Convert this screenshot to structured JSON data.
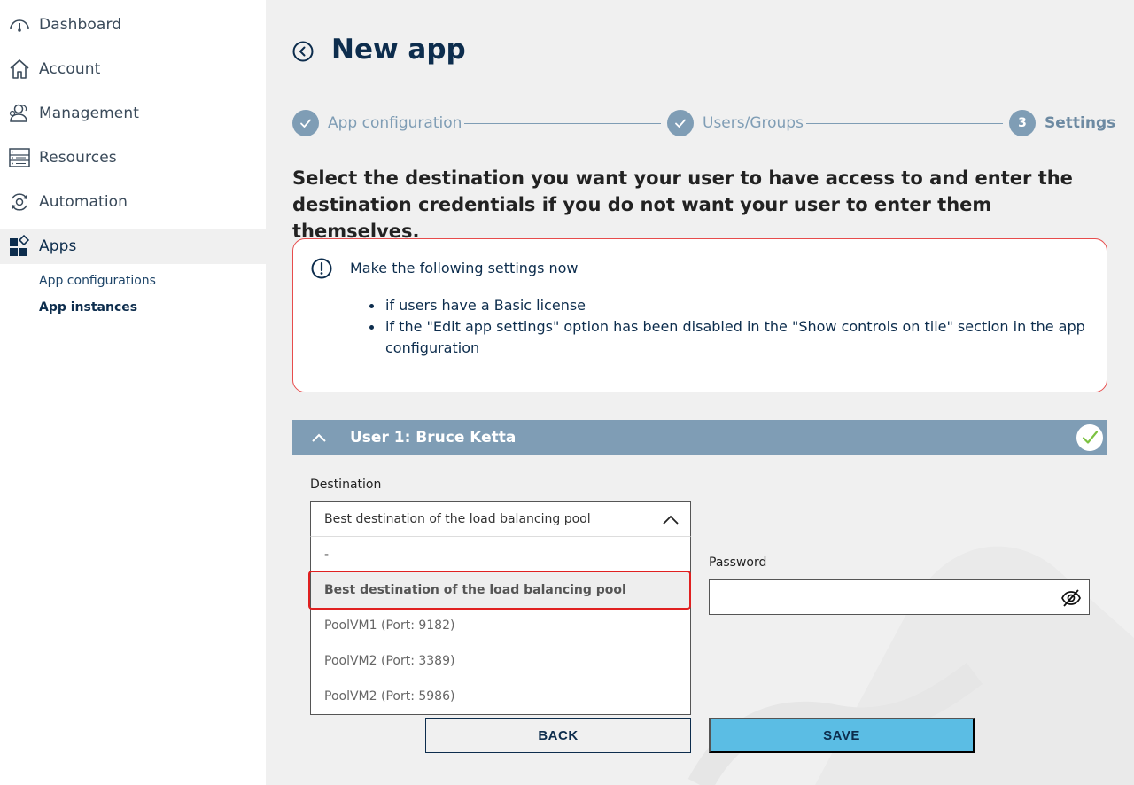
{
  "sidebar": {
    "items": [
      {
        "label": "Dashboard",
        "icon": "gauge-icon"
      },
      {
        "label": "Account",
        "icon": "home-icon"
      },
      {
        "label": "Management",
        "icon": "users-icon"
      },
      {
        "label": "Resources",
        "icon": "server-icon"
      },
      {
        "label": "Automation",
        "icon": "automation-icon"
      },
      {
        "label": "Apps",
        "icon": "apps-icon"
      }
    ],
    "active_item": "Apps",
    "sub_items": [
      {
        "label": "App configurations"
      },
      {
        "label": "App instances"
      }
    ],
    "active_sub_item": "App instances"
  },
  "page": {
    "title": "New app",
    "heading": "Select the destination you want your user to have access to and enter the destination credentials if you do not want your user to enter them themselves."
  },
  "stepper": {
    "steps": [
      {
        "label": "App configuration",
        "state": "done"
      },
      {
        "label": "Users/Groups",
        "state": "done"
      },
      {
        "label": "Settings",
        "state": "current",
        "number": "3"
      }
    ]
  },
  "notice": {
    "title": "Make the following settings now",
    "bullets": [
      "if users have a Basic license",
      "if the \"Edit app settings\" option has been disabled in the \"Show controls on tile\" section in the app configuration"
    ]
  },
  "user_section": {
    "title": "User 1: Bruce Ketta",
    "status": "complete"
  },
  "destination": {
    "label": "Destination",
    "value": "Best destination of the load balancing pool",
    "options": [
      "-",
      "Best destination of the load balancing pool",
      "PoolVM1 (Port: 9182)",
      "PoolVM2 (Port: 3389)",
      "PoolVM2 (Port: 5986)"
    ],
    "selected_option": "Best destination of the load balancing pool"
  },
  "password": {
    "label": "Password",
    "value": ""
  },
  "buttons": {
    "back": "BACK",
    "save": "SAVE"
  },
  "colors": {
    "navy": "#0d2d4d",
    "step_blue": "#7f9db5",
    "save_blue": "#5bbde4",
    "alert_red": "#e74c4c",
    "check_green": "#7cc242"
  }
}
